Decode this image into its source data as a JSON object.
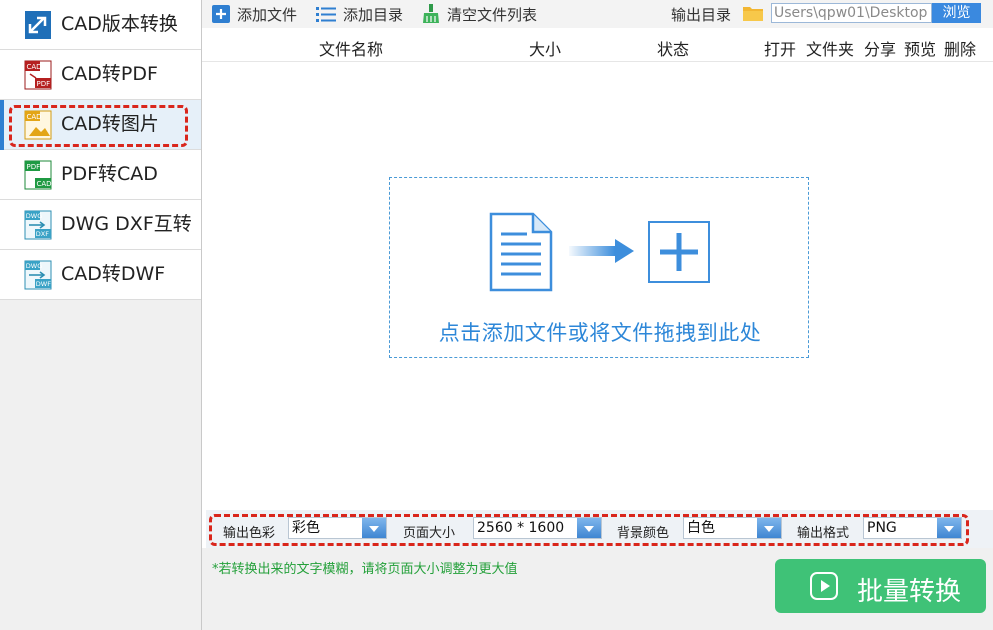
{
  "sidebar": {
    "items": [
      {
        "label": "CAD版本转换",
        "icon": "cad-version-icon",
        "active": false
      },
      {
        "label": "CAD转PDF",
        "icon": "cad-to-pdf-icon",
        "active": false
      },
      {
        "label": "CAD转图片",
        "icon": "cad-to-image-icon",
        "active": true
      },
      {
        "label": "PDF转CAD",
        "icon": "pdf-to-cad-icon",
        "active": false
      },
      {
        "label": "DWG DXF互转",
        "icon": "dwg-dxf-icon",
        "active": false
      },
      {
        "label": "CAD转DWF",
        "icon": "dwg-to-dwf-icon",
        "active": false
      }
    ],
    "icon_text": {
      "cad_pdf": [
        "CAD",
        "PDF"
      ],
      "cad_img": [
        "CAD"
      ],
      "pdf_cad": [
        "PDF",
        "CAD"
      ],
      "dwg_dxf": [
        "DWG",
        "DXF"
      ],
      "dwg_dwf": [
        "DWG",
        "DWF"
      ]
    }
  },
  "toolbar": {
    "add_file": "添加文件",
    "add_folder": "添加目录",
    "clear_list": "清空文件列表",
    "output_dir_label": "输出目录",
    "output_path": "Users\\qpw01\\Desktop",
    "browse": "浏览"
  },
  "table": {
    "columns": [
      "文件名称",
      "大小",
      "状态",
      "打开",
      "文件夹",
      "分享",
      "预览",
      "删除"
    ]
  },
  "dropzone": {
    "text": "点击添加文件或将文件拖拽到此处"
  },
  "options": {
    "color_label": "输出色彩",
    "color_value": "彩色",
    "page_size_label": "页面大小",
    "page_size_value": "2560 * 1600",
    "bg_label": "背景颜色",
    "bg_value": "白色",
    "format_label": "输出格式",
    "format_value": "PNG"
  },
  "footer": {
    "hint": "*若转换出来的文字模糊，请将页面大小调整为更大值",
    "convert": "批量转换"
  },
  "colors": {
    "accent": "#2f7fd1",
    "convert_button": "#3fc277",
    "hint_text": "#24a03a",
    "highlight_dash": "#d9261c"
  }
}
